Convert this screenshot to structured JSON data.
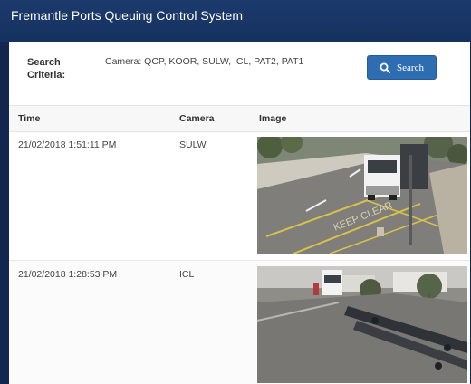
{
  "app": {
    "title": "Fremantle Ports Queuing Control System"
  },
  "search": {
    "label": "Search Criteria:",
    "criteria": "Camera: QCP, KOOR, SULW, ICL, PAT2, PAT1",
    "button_label": "Search",
    "button_icon": "search-icon"
  },
  "table": {
    "columns": [
      "Time",
      "Camera",
      "Image"
    ],
    "rows": [
      {
        "time": "21/02/2018 1:51:11 PM",
        "camera": "SULW"
      },
      {
        "time": "21/02/2018 1:28:53 PM",
        "camera": "ICL"
      }
    ]
  },
  "colors": {
    "title_bar": "#16315f",
    "button": "#2e6db1"
  }
}
